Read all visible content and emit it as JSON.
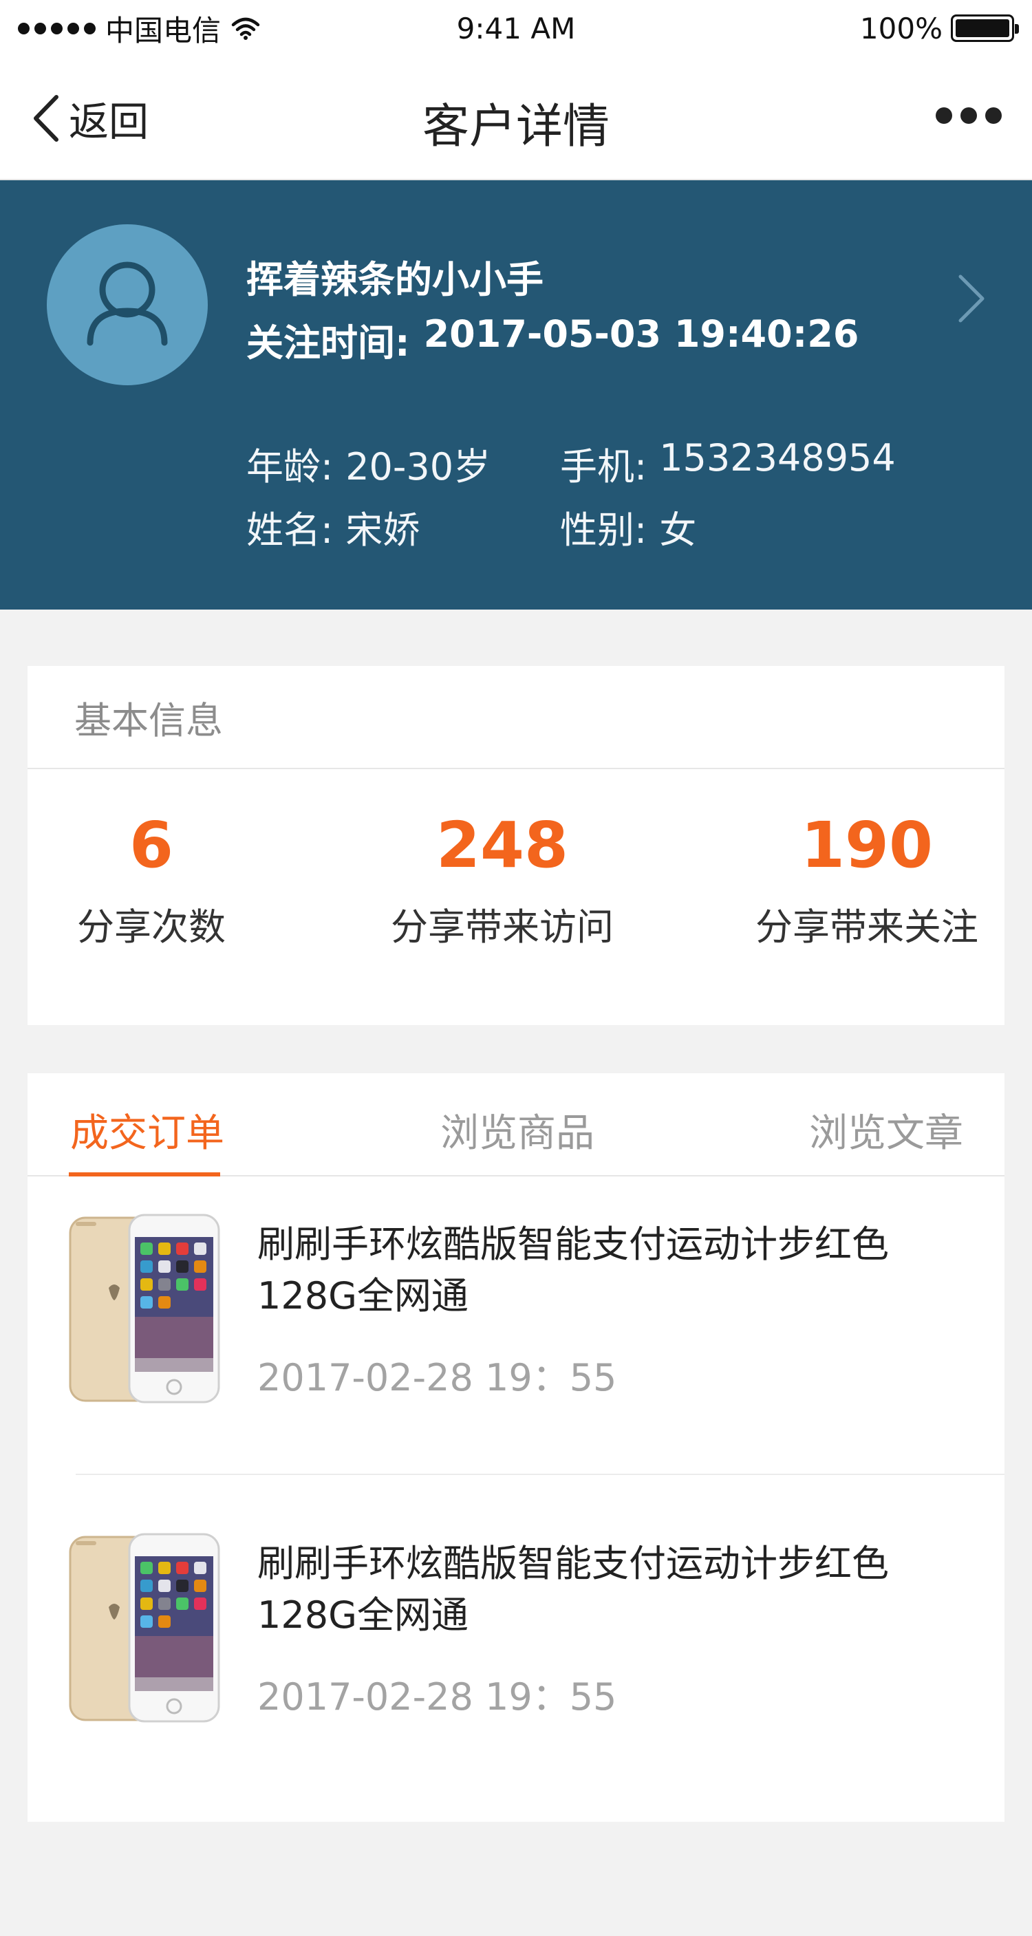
{
  "status_bar": {
    "carrier": "中国电信",
    "time": "9:41 AM",
    "battery": "100%"
  },
  "nav": {
    "back_label": "返回",
    "title": "客户详情"
  },
  "profile": {
    "nickname": "挥着辣条的小小手",
    "follow_label": "关注时间:",
    "follow_time": "2017-05-03 19:40:26",
    "age_label": "年龄:",
    "age": "20-30岁",
    "phone_label": "手机:",
    "phone": "1532348954",
    "name_label": "姓名:",
    "name": "宋娇",
    "gender_label": "性别:",
    "gender": "女"
  },
  "stats": {
    "header": "基本信息",
    "items": [
      {
        "value": "6",
        "label": "分享次数"
      },
      {
        "value": "248",
        "label": "分享带来访问"
      },
      {
        "value": "190",
        "label": "分享带来关注"
      }
    ]
  },
  "tabs": [
    {
      "label": "成交订单",
      "active": true
    },
    {
      "label": "浏览商品",
      "active": false
    },
    {
      "label": "浏览文章",
      "active": false
    }
  ],
  "orders": [
    {
      "title": "刷刷手环炫酷版智能支付运动计步红色128G全网通",
      "time": "2017-02-28 19：55"
    },
    {
      "title": "刷刷手环炫酷版智能支付运动计步红色128G全网通",
      "time": "2017-02-28 19：55"
    }
  ],
  "colors": {
    "header_bg": "#245774",
    "avatar_bg": "#5ea0c2",
    "accent": "#f3651d",
    "page_bg": "#f2f2f2"
  },
  "icons": [
    "back-chevron-icon",
    "more-dots-icon",
    "user-icon",
    "chevron-right-icon",
    "wifi-icon",
    "battery-icon"
  ]
}
